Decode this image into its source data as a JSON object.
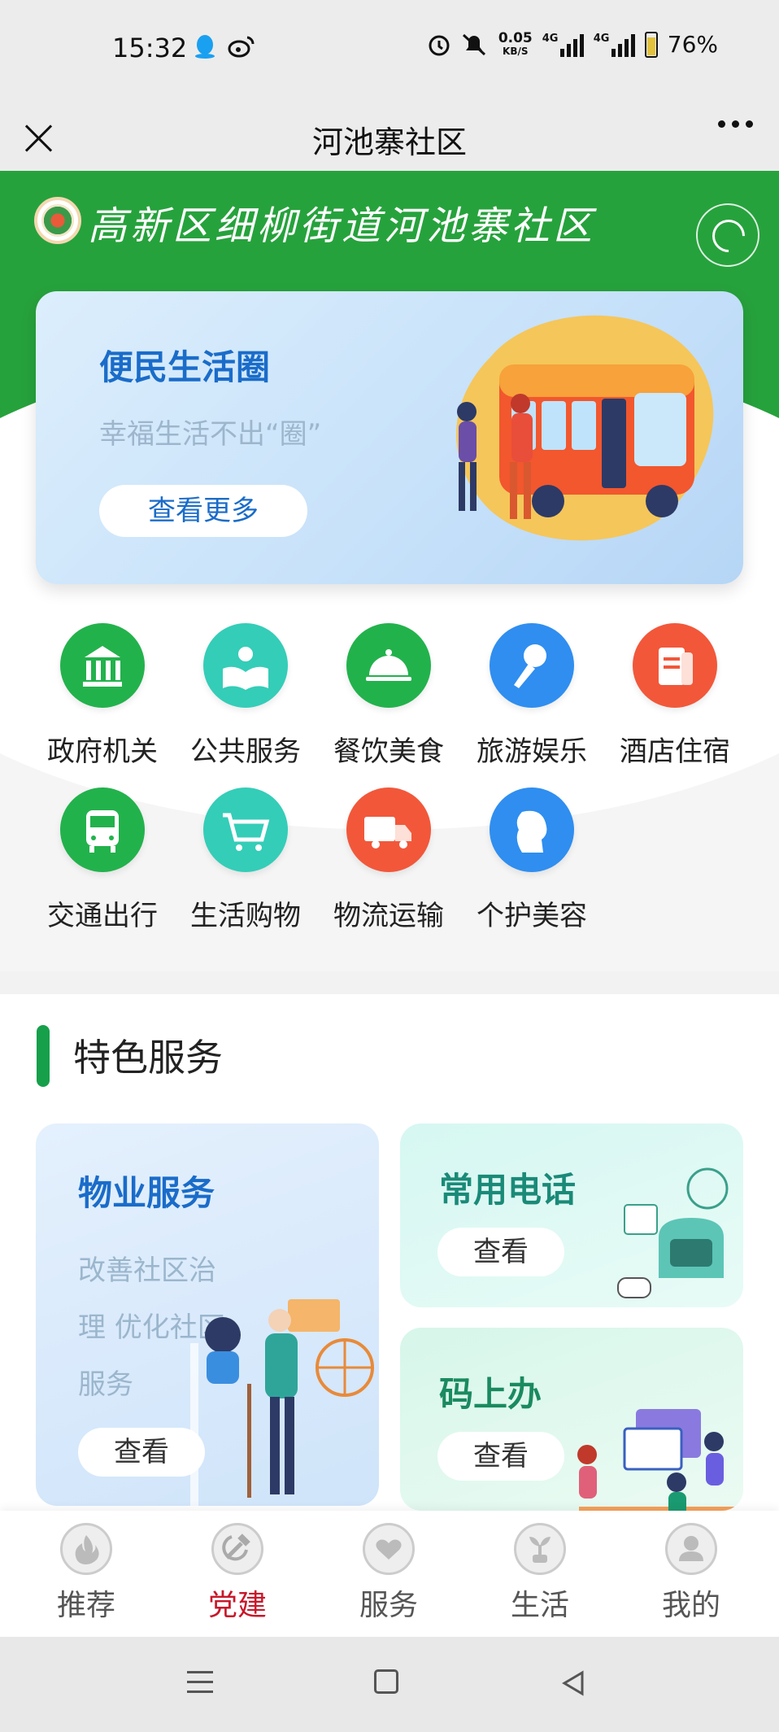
{
  "status_bar": {
    "time": "15:32",
    "net_speed_value": "0.05",
    "net_speed_unit": "KB/S",
    "signal_1_label": "4G",
    "signal_2_label": "4G",
    "battery": "76%"
  },
  "nav": {
    "title": "河池寨社区"
  },
  "header": {
    "title": "高新区细柳街道河池寨社区",
    "accent_color": "#26a23c"
  },
  "banner": {
    "title": "便民生活圈",
    "subtitle": "幸福生活不出“圈”",
    "button": "查看更多"
  },
  "categories": [
    {
      "label": "政府机关",
      "icon": "government-building-icon",
      "color": "#22b24c"
    },
    {
      "label": "公共服务",
      "icon": "reading-person-icon",
      "color": "#34cdb8"
    },
    {
      "label": "餐饮美食",
      "icon": "food-cloche-icon",
      "color": "#22b24c"
    },
    {
      "label": "旅游娱乐",
      "icon": "microphone-icon",
      "color": "#2f8ef0"
    },
    {
      "label": "酒店住宿",
      "icon": "document-icon",
      "color": "#f2573a"
    },
    {
      "label": "交通出行",
      "icon": "bus-icon",
      "color": "#22b24c"
    },
    {
      "label": "生活购物",
      "icon": "shopping-cart-icon",
      "color": "#34cdb8"
    },
    {
      "label": "物流运输",
      "icon": "truck-icon",
      "color": "#f2573a"
    },
    {
      "label": "个护美容",
      "icon": "face-profile-icon",
      "color": "#2f8ef0"
    }
  ],
  "featured": {
    "section_title": "特色服务",
    "cards": [
      {
        "title": "物业服务",
        "desc": "改善社区治理 优化社区服务",
        "button": "查看",
        "title_color": "#1a6cc9"
      },
      {
        "title": "常用电话",
        "button": "查看",
        "title_color": "#1a8a78"
      },
      {
        "title": "码上办",
        "button": "查看",
        "title_color": "#1a8a60"
      }
    ]
  },
  "tabs": [
    {
      "label": "推荐",
      "icon": "flame-icon",
      "active": false
    },
    {
      "label": "党建",
      "icon": "hammer-sickle-icon",
      "active": true
    },
    {
      "label": "服务",
      "icon": "heart-hand-icon",
      "active": false
    },
    {
      "label": "生活",
      "icon": "plant-icon",
      "active": false
    },
    {
      "label": "我的",
      "icon": "user-icon",
      "active": false
    }
  ]
}
